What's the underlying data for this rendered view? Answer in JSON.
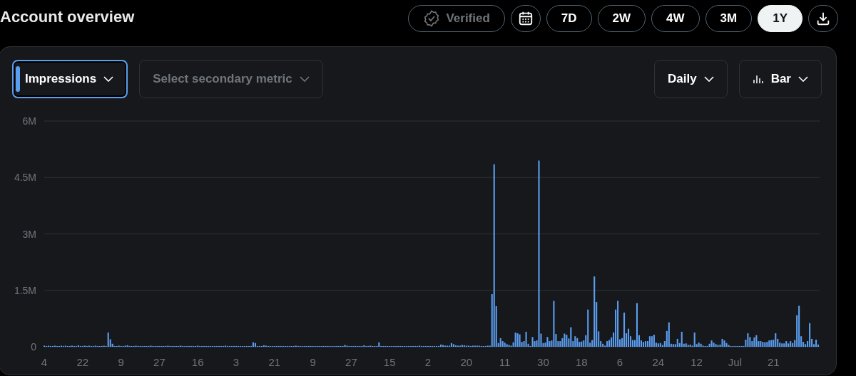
{
  "title": "Account overview",
  "verified": {
    "label": "Verified",
    "disabled": true
  },
  "ranges": [
    {
      "label": "7D",
      "selected": false
    },
    {
      "label": "2W",
      "selected": false
    },
    {
      "label": "4W",
      "selected": false
    },
    {
      "label": "3M",
      "selected": false
    },
    {
      "label": "1Y",
      "selected": true
    }
  ],
  "metric": {
    "label": "Impressions",
    "focused": true
  },
  "secondary": {
    "placeholder": "Select secondary metric"
  },
  "interval": {
    "label": "Daily"
  },
  "chart_type": {
    "label": "Bar"
  },
  "chart_data": {
    "type": "bar",
    "categories": [
      "4",
      null,
      null,
      null,
      null,
      null,
      null,
      null,
      null,
      null,
      null,
      null,
      null,
      null,
      null,
      null,
      null,
      null,
      "22",
      null,
      null,
      null,
      null,
      null,
      null,
      null,
      null,
      null,
      null,
      null,
      null,
      null,
      null,
      null,
      null,
      null,
      "9",
      null,
      null,
      null,
      null,
      null,
      null,
      null,
      null,
      null,
      null,
      null,
      null,
      null,
      null,
      null,
      null,
      null,
      "27",
      null,
      null,
      null,
      null,
      null,
      null,
      null,
      null,
      null,
      null,
      null,
      null,
      null,
      null,
      null,
      null,
      null,
      "16",
      null,
      null,
      null,
      null,
      null,
      null,
      null,
      null,
      null,
      null,
      null,
      null,
      null,
      null,
      null,
      null,
      null,
      "3",
      null,
      null,
      null,
      null,
      null,
      null,
      null,
      null,
      null,
      null,
      null,
      null,
      null,
      null,
      null,
      null,
      null,
      "21",
      null,
      null,
      null,
      null,
      null,
      null,
      null,
      null,
      null,
      null,
      null,
      null,
      null,
      null,
      null,
      null,
      null,
      "9",
      null,
      null,
      null,
      null,
      null,
      null,
      null,
      null,
      null,
      null,
      null,
      null,
      null,
      null,
      null,
      null,
      null,
      "27",
      null,
      null,
      null,
      null,
      null,
      null,
      null,
      null,
      null,
      null,
      null,
      null,
      null,
      null,
      null,
      null,
      null,
      "15",
      null,
      null,
      null,
      null,
      null,
      null,
      null,
      null,
      null,
      null,
      null,
      null,
      null,
      null,
      null,
      null,
      null,
      "2",
      null,
      null,
      null,
      null,
      null,
      null,
      null,
      null,
      null,
      null,
      null,
      null,
      null,
      null,
      null,
      null,
      null,
      "20",
      null,
      null,
      null,
      null,
      null,
      null,
      null,
      null,
      null,
      null,
      null,
      null,
      null,
      null,
      null,
      null,
      null,
      "11",
      null,
      null,
      null,
      null,
      null,
      null,
      null,
      null,
      null,
      null,
      null,
      null,
      null,
      null,
      null,
      null,
      null,
      "30",
      null,
      null,
      null,
      null,
      null,
      null,
      null,
      null,
      null,
      null,
      null,
      null,
      null,
      null,
      null,
      null,
      null,
      "18",
      null,
      null,
      null,
      null,
      null,
      null,
      null,
      null,
      null,
      null,
      null,
      null,
      null,
      null,
      null,
      null,
      null,
      "6",
      null,
      null,
      null,
      null,
      null,
      null,
      null,
      null,
      null,
      null,
      null,
      null,
      null,
      null,
      null,
      null,
      null,
      "24",
      null,
      null,
      null,
      null,
      null,
      null,
      null,
      null,
      null,
      null,
      null,
      null,
      null,
      null,
      null,
      null,
      null,
      "12",
      null,
      null,
      null,
      null,
      null,
      null,
      null,
      null,
      null,
      null,
      null,
      null,
      null,
      null,
      null,
      null,
      null,
      "Jul",
      null,
      null,
      null,
      null,
      null,
      null,
      null,
      null,
      null,
      null,
      null,
      null,
      null,
      null,
      null,
      null,
      null,
      "21",
      null,
      null,
      null,
      null,
      null,
      null,
      null,
      null,
      null,
      null,
      null,
      null,
      null,
      null,
      null,
      null,
      null,
      null,
      null,
      null,
      null
    ],
    "yticks": [
      {
        "value": 0,
        "label": "0"
      },
      {
        "value": 1.5,
        "label": "1.5M"
      },
      {
        "value": 3,
        "label": "3M"
      },
      {
        "value": 4.5,
        "label": "4.5M"
      },
      {
        "value": 6,
        "label": "6M"
      }
    ],
    "ylim": [
      0,
      6
    ],
    "grid": true,
    "series": [
      {
        "color": "#5b9ef0",
        "values": [
          0.03,
          0.02,
          0.03,
          0.02,
          0.02,
          0.03,
          0.02,
          0.02,
          0.03,
          0.02,
          0.03,
          0.02,
          0.02,
          0.03,
          0.02,
          0.02,
          0.04,
          0.02,
          0.02,
          0.03,
          0.02,
          0.03,
          0.02,
          0.02,
          0.03,
          0.02,
          0.02,
          0.02,
          0.03,
          0.02,
          0.38,
          0.2,
          0.08,
          0.02,
          0.02,
          0.03,
          0.02,
          0.02,
          0.03,
          0.04,
          0.02,
          0.02,
          0.02,
          0.03,
          0.02,
          0.02,
          0.02,
          0.02,
          0.02,
          0.02,
          0.03,
          0.02,
          0.02,
          0.02,
          0.02,
          0.02,
          0.02,
          0.02,
          0.03,
          0.02,
          0.02,
          0.02,
          0.02,
          0.02,
          0.03,
          0.02,
          0.02,
          0.02,
          0.02,
          0.02,
          0.02,
          0.02,
          0.03,
          0.02,
          0.02,
          0.02,
          0.02,
          0.02,
          0.02,
          0.02,
          0.02,
          0.02,
          0.02,
          0.02,
          0.02,
          0.03,
          0.02,
          0.02,
          0.02,
          0.02,
          0.02,
          0.02,
          0.02,
          0.02,
          0.02,
          0.02,
          0.02,
          0.02,
          0.12,
          0.1,
          0.02,
          0.02,
          0.02,
          0.04,
          0.03,
          0.02,
          0.02,
          0.02,
          0.02,
          0.02,
          0.02,
          0.02,
          0.02,
          0.02,
          0.02,
          0.02,
          0.02,
          0.02,
          0.03,
          0.02,
          0.02,
          0.02,
          0.02,
          0.02,
          0.02,
          0.02,
          0.02,
          0.02,
          0.02,
          0.02,
          0.02,
          0.02,
          0.02,
          0.02,
          0.02,
          0.02,
          0.02,
          0.02,
          0.02,
          0.02,
          0.02,
          0.05,
          0.03,
          0.02,
          0.02,
          0.02,
          0.02,
          0.02,
          0.02,
          0.02,
          0.04,
          0.02,
          0.02,
          0.03,
          0.02,
          0.02,
          0.02,
          0.12,
          0.02,
          0.02,
          0.02,
          0.02,
          0.02,
          0.02,
          0.02,
          0.02,
          0.02,
          0.02,
          0.02,
          0.02,
          0.02,
          0.02,
          0.02,
          0.02,
          0.02,
          0.02,
          0.03,
          0.02,
          0.02,
          0.02,
          0.02,
          0.02,
          0.02,
          0.02,
          0.02,
          0.02,
          0.06,
          0.05,
          0.03,
          0.03,
          0.03,
          0.1,
          0.07,
          0.04,
          0.03,
          0.03,
          0.05,
          0.04,
          0.03,
          0.03,
          0.02,
          0.03,
          0.03,
          0.03,
          0.03,
          0.02,
          0.02,
          0.02,
          0.03,
          0.03,
          1.4,
          4.85,
          1.08,
          0.1,
          0.23,
          0.15,
          0.11,
          0.07,
          0.05,
          0.03,
          0.12,
          0.38,
          0.36,
          0.33,
          0.13,
          0.15,
          0.4,
          0.08,
          0.02,
          0.26,
          0.15,
          0.17,
          4.95,
          0.35,
          0.1,
          0.11,
          0.26,
          0.15,
          0.17,
          1.22,
          0.34,
          0.15,
          0.15,
          0.23,
          0.35,
          0.32,
          0.22,
          0.52,
          0.15,
          0.28,
          0.23,
          0.13,
          0.14,
          0.17,
          0.31,
          0.99,
          0.11,
          0.18,
          1.87,
          1.19,
          0.41,
          0.15,
          0.08,
          0.03,
          0.15,
          0.18,
          0.25,
          0.38,
          0.99,
          1.22,
          0.2,
          0.23,
          0.91,
          0.36,
          0.48,
          0.28,
          0.18,
          0.18,
          1.16,
          0.31,
          0.17,
          0.13,
          0.15,
          0.15,
          0.28,
          0.28,
          0.32,
          0.11,
          0.09,
          0.1,
          0.05,
          0.15,
          0.42,
          0.65,
          0.08,
          0.07,
          0.07,
          0.21,
          0.1,
          0.4,
          0.08,
          0.09,
          0.05,
          0.06,
          0.03,
          0.38,
          0.07,
          0.11,
          0.08,
          0.03,
          0.02,
          0.02,
          0.08,
          0.17,
          0.11,
          0.07,
          0.05,
          0.06,
          0.21,
          0.17,
          0.1,
          0.05,
          0.02,
          0.02,
          0.02,
          0.02,
          0.02,
          0.02,
          0.02,
          0.19,
          0.36,
          0.26,
          0.15,
          0.25,
          0.31,
          0.15,
          0.15,
          0.13,
          0.12,
          0.13,
          0.17,
          0.18,
          0.19,
          0.36,
          0.21,
          0.11,
          0.09,
          0.09,
          0.15,
          0.09,
          0.15,
          0.1,
          0.18,
          0.84,
          1.09,
          0.28,
          0.13,
          0.07,
          0.15,
          0.63,
          0.21,
          0.07,
          0.19,
          0.06
        ]
      }
    ]
  }
}
